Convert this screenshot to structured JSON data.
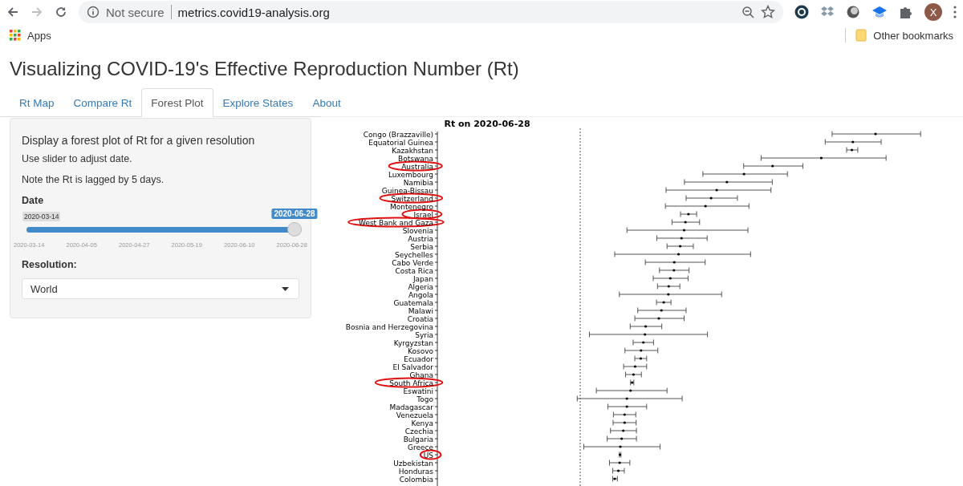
{
  "browser": {
    "forward_disabled": true,
    "security_label": "Not secure",
    "url": "metrics.covid19-analysis.org",
    "avatar_letter": "X",
    "bookmarks": [
      {
        "label": "Apps"
      },
      {
        "label": "Other bookmarks"
      }
    ]
  },
  "page": {
    "title": "Visualizing COVID-19's Effective Reproduction Number (Rt)",
    "tabs": [
      {
        "label": "Rt Map",
        "selected": false
      },
      {
        "label": "Compare Rt",
        "selected": false
      },
      {
        "label": "Forest Plot",
        "selected": true
      },
      {
        "label": "Explore States",
        "selected": false
      },
      {
        "label": "About",
        "selected": false
      }
    ],
    "sidebar": {
      "heading": "Display a forest plot of Rt for a given resolution",
      "notes": [
        "Use slider to adjust date.",
        "Note the Rt is lagged by 5 days."
      ],
      "date_label": "Date",
      "slider": {
        "min_label": "2020-03-14",
        "value_label": "2020-06-28",
        "level": 1,
        "ticks": [
          "2020-03-14",
          "2020-04-05",
          "2020-04-27",
          "2020-05-19",
          "2020-06-10",
          "2020-06-28"
        ]
      },
      "resolution_label": "Resolution:",
      "resolution_value": "World"
    },
    "forest_plot": {
      "title": "Rt on 2020-06-28",
      "rows": [
        {
          "label": "Congo (Brazzaville)",
          "circled": false
        },
        {
          "label": "Equatorial Guinea",
          "circled": false
        },
        {
          "label": "Kazakhstan",
          "circled": false
        },
        {
          "label": "Botswana",
          "circled": false
        },
        {
          "label": "Australia",
          "circled": true
        },
        {
          "label": "Luxembourg",
          "circled": false
        },
        {
          "label": "Namibia",
          "circled": false
        },
        {
          "label": "Guinea-Bissau",
          "circled": false
        },
        {
          "label": "Switzerland",
          "circled": true
        },
        {
          "label": "Montenegro",
          "circled": false
        },
        {
          "label": "Israel",
          "circled": true
        },
        {
          "label": "West Bank and Gaza",
          "circled": true
        },
        {
          "label": "Slovenia",
          "circled": false
        },
        {
          "label": "Austria",
          "circled": false
        },
        {
          "label": "Serbia",
          "circled": false
        },
        {
          "label": "Seychelles",
          "circled": false
        },
        {
          "label": "Cabo Verde",
          "circled": false
        },
        {
          "label": "Costa Rica",
          "circled": false
        },
        {
          "label": "Japan",
          "circled": false
        },
        {
          "label": "Algeria",
          "circled": false
        },
        {
          "label": "Angola",
          "circled": false
        },
        {
          "label": "Guatemala",
          "circled": false
        },
        {
          "label": "Malawi",
          "circled": false
        },
        {
          "label": "Croatia",
          "circled": false
        },
        {
          "label": "Bosnia and Herzegovina",
          "circled": false
        },
        {
          "label": "Syria",
          "circled": false
        },
        {
          "label": "Kyrgyzstan",
          "circled": false
        },
        {
          "label": "Kosovo",
          "circled": false
        },
        {
          "label": "Ecuador",
          "circled": false
        },
        {
          "label": "El Salvador",
          "circled": false
        },
        {
          "label": "Ghana",
          "circled": false
        },
        {
          "label": "South Africa",
          "circled": true
        },
        {
          "label": "Eswatini",
          "circled": false
        },
        {
          "label": "Togo",
          "circled": false
        },
        {
          "label": "Madagascar",
          "circled": false
        },
        {
          "label": "Venezuela",
          "circled": false
        },
        {
          "label": "Kenya",
          "circled": false
        },
        {
          "label": "Czechia",
          "circled": false
        },
        {
          "label": "Bulgaria",
          "circled": false
        },
        {
          "label": "Greece",
          "circled": false
        },
        {
          "label": "US",
          "circled": true
        },
        {
          "label": "Uzbekistan",
          "circled": false
        },
        {
          "label": "Honduras",
          "circled": false
        },
        {
          "label": "Colombia",
          "circled": false
        }
      ]
    }
  }
}
